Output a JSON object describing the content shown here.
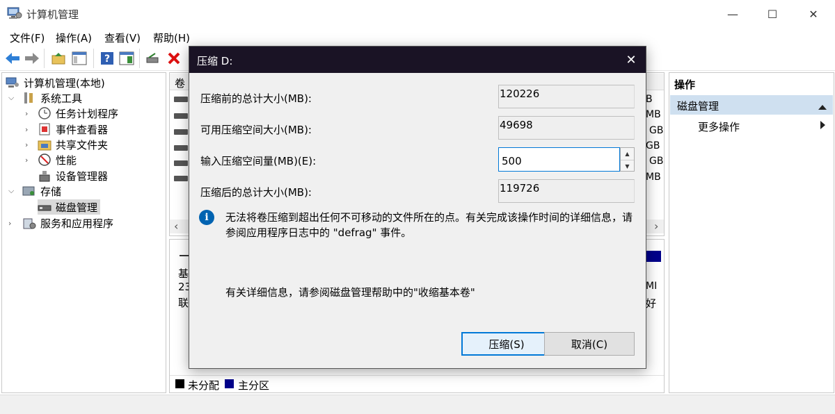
{
  "window": {
    "title": "计算机管理",
    "minimize": "—",
    "maximize": "☐",
    "close": "✕"
  },
  "menu": [
    "文件(F)",
    "操作(A)",
    "查看(V)",
    "帮助(H)"
  ],
  "tree": {
    "root": "计算机管理(本地)",
    "system_tools": "系统工具",
    "task_scheduler": "任务计划程序",
    "event_viewer": "事件查看器",
    "shared_folders": "共享文件夹",
    "performance": "性能",
    "device_manager": "设备管理器",
    "storage": "存储",
    "disk_management": "磁盘管理",
    "services": "服务和应用程序"
  },
  "center": {
    "column_header": "卷",
    "right_fragments": [
      "B",
      "MB",
      "GB",
      "GB",
      "GB",
      "MB"
    ],
    "scroll_left": "‹",
    "scroll_right": "›",
    "bottom_fragments": [
      "基",
      "23",
      "联"
    ],
    "bottom_right_fragments": [
      "MI",
      "好"
    ],
    "legend": [
      "未分配",
      "主分区"
    ]
  },
  "actions": {
    "title": "操作",
    "section": "磁盘管理",
    "more": "更多操作"
  },
  "dialog": {
    "title": "压缩 D:",
    "close": "✕",
    "total_before_label": "压缩前的总计大小(MB):",
    "total_before_value": "120226",
    "available_label": "可用压缩空间大小(MB):",
    "available_value": "49698",
    "input_label": "输入压缩空间量(MB)(E):",
    "input_value": "500",
    "total_after_label": "压缩后的总计大小(MB):",
    "total_after_value": "119726",
    "info_icon": "i",
    "info_text": "无法将卷压缩到超出任何不可移动的文件所在的点。有关完成该操作时间的详细信息，请参阅应用程序日志中的 \"defrag\" 事件。",
    "detail_text": "有关详细信息，请参阅磁盘管理帮助中的\"收缩基本卷\"",
    "shrink_button": "压缩(S)",
    "cancel_button": "取消(C)"
  },
  "colors": {
    "dialog_title_bg": "#1a1325",
    "accent": "#0078d7",
    "primary_partition": "#00008b",
    "unallocated": "#000000"
  }
}
